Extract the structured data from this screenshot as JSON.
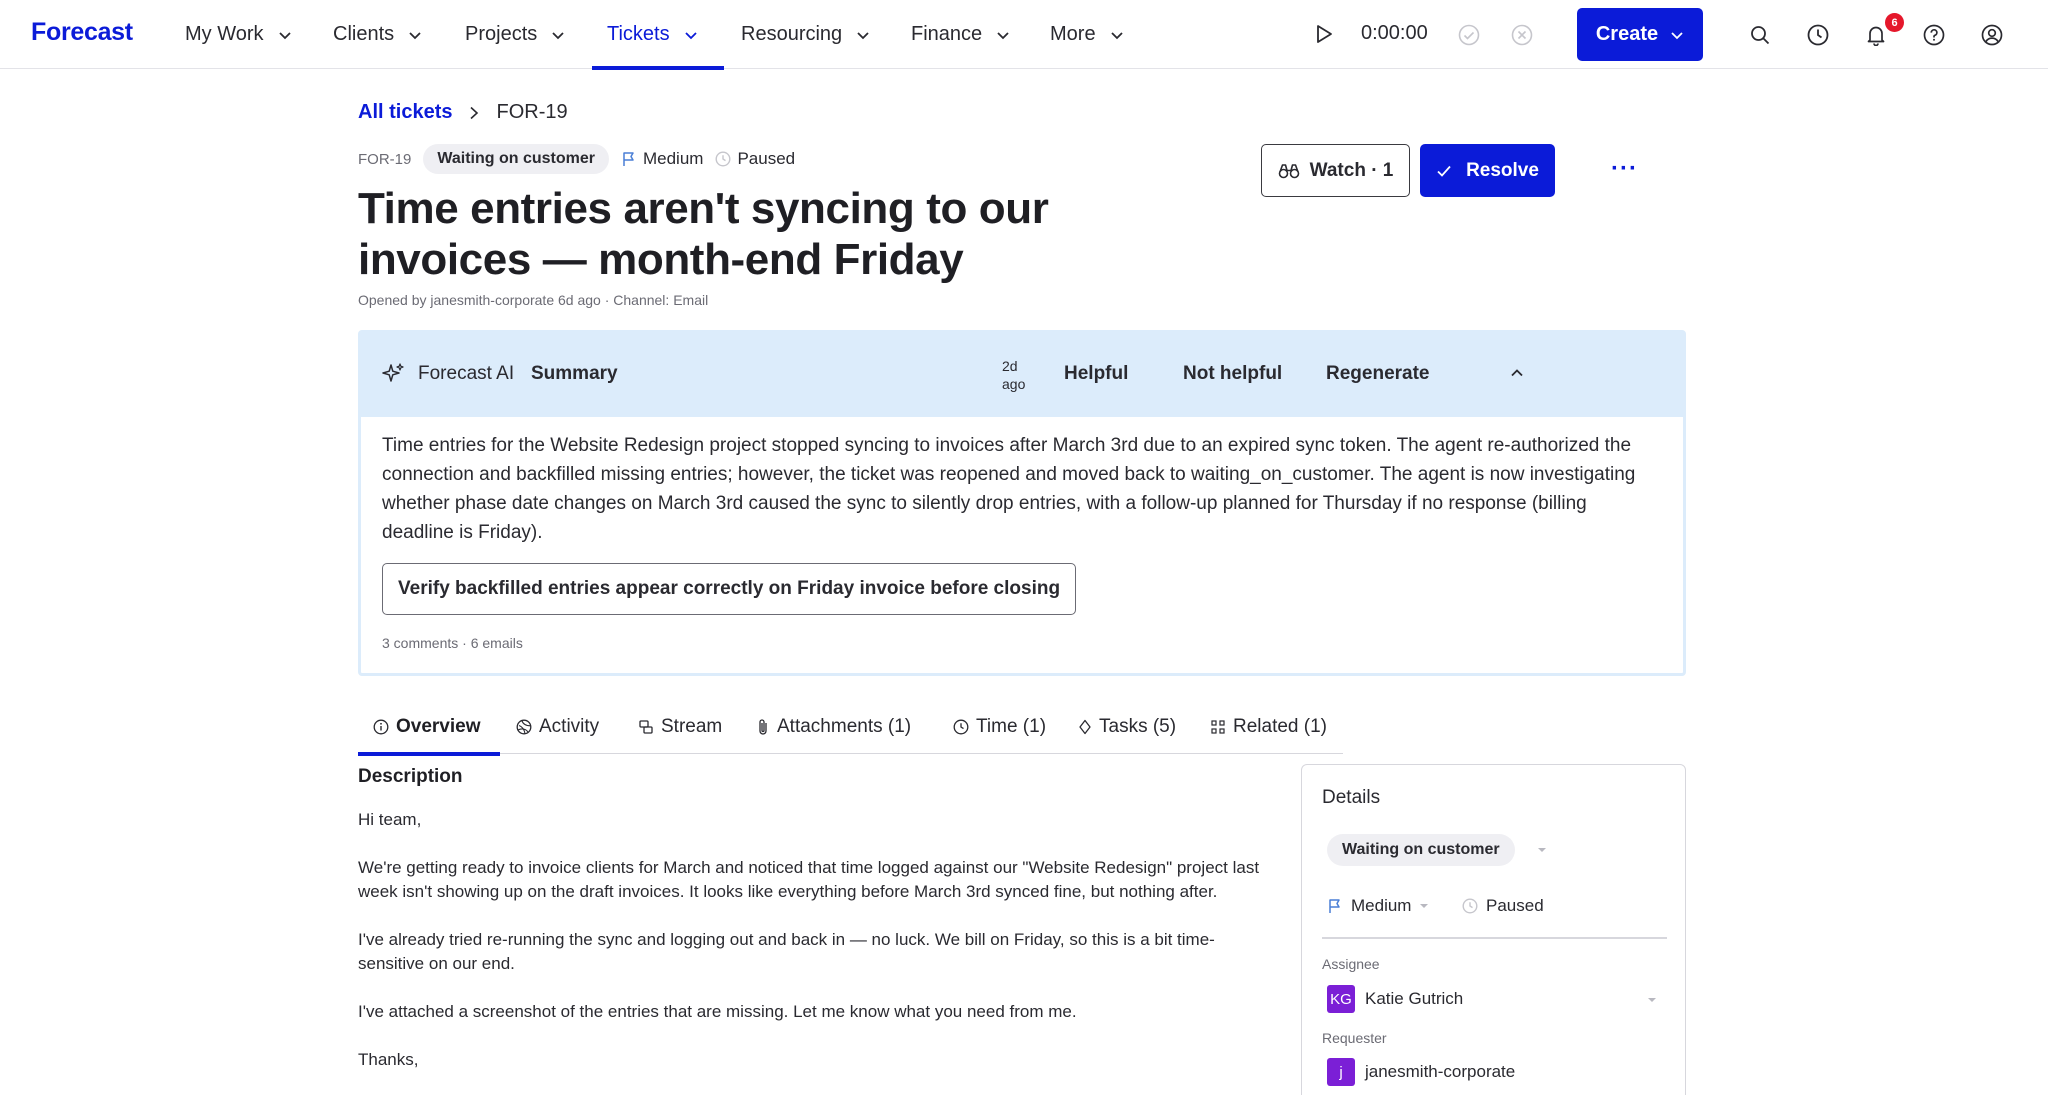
{
  "nav": {
    "brand": "Forecast",
    "items": [
      "My Work",
      "Clients",
      "Projects",
      "Tickets",
      "Resourcing",
      "Finance",
      "More"
    ],
    "active": "Tickets",
    "timer": "0:00:00",
    "create_label": "Create",
    "notification_count": "6",
    "accent_color": "#0b1bd8"
  },
  "breadcrumb": {
    "parent": "All tickets",
    "current": "FOR-19"
  },
  "ticket": {
    "id": "FOR-19",
    "status": "Waiting on customer",
    "priority": "Medium",
    "sla": "Paused",
    "title": "Time entries aren't syncing to our invoices — month-end Friday",
    "opened": "Opened by janesmith-corporate 6d ago · Channel: Email",
    "watch_label": "Watch · 1",
    "resolve_label": "Resolve"
  },
  "ai_summary": {
    "brand": "Forecast AI",
    "heading": "Summary",
    "age": "2d ago",
    "helpful": "Helpful",
    "not_helpful": "Not helpful",
    "regenerate": "Regenerate",
    "body": "Time entries for the Website Redesign project stopped syncing to invoices after March 3rd due to an expired sync token. The agent re-authorized the connection and backfilled missing entries; however, the ticket was reopened and moved back to waiting_on_customer. The agent is now investigating whether phase date changes on March 3rd caused the sync to silently drop entries, with a follow-up planned for Thursday if no response (billing deadline is Friday).",
    "action": "Verify backfilled entries appear correctly on Friday invoice before closing",
    "footer": "3 comments · 6 emails"
  },
  "tabs": [
    "Overview",
    "Activity",
    "Stream",
    "Attachments (1)",
    "Time (1)",
    "Tasks (5)",
    "Related (1)"
  ],
  "description": {
    "title": "Description",
    "paragraphs": [
      "Hi team,",
      "We're getting ready to invoice clients for March and noticed that time logged against our \"Website Redesign\" project last week isn't showing up on the draft invoices. It looks like everything before March 3rd synced fine, but nothing after.",
      "I've already tried re-running the sync and logging out and back in — no luck. We bill on Friday, so this is a bit time-sensitive on our end.",
      "I've attached a screenshot of the entries that are missing. Let me know what you need from me.",
      "Thanks,"
    ]
  },
  "details": {
    "title": "Details",
    "status": "Waiting on customer",
    "priority": "Medium",
    "sla": "Paused",
    "assignee_label": "Assignee",
    "assignee_initials": "KG",
    "assignee_name": "Katie Gutrich",
    "requester_label": "Requester",
    "requester_initial": "j",
    "requester_name": "janesmith-corporate"
  }
}
